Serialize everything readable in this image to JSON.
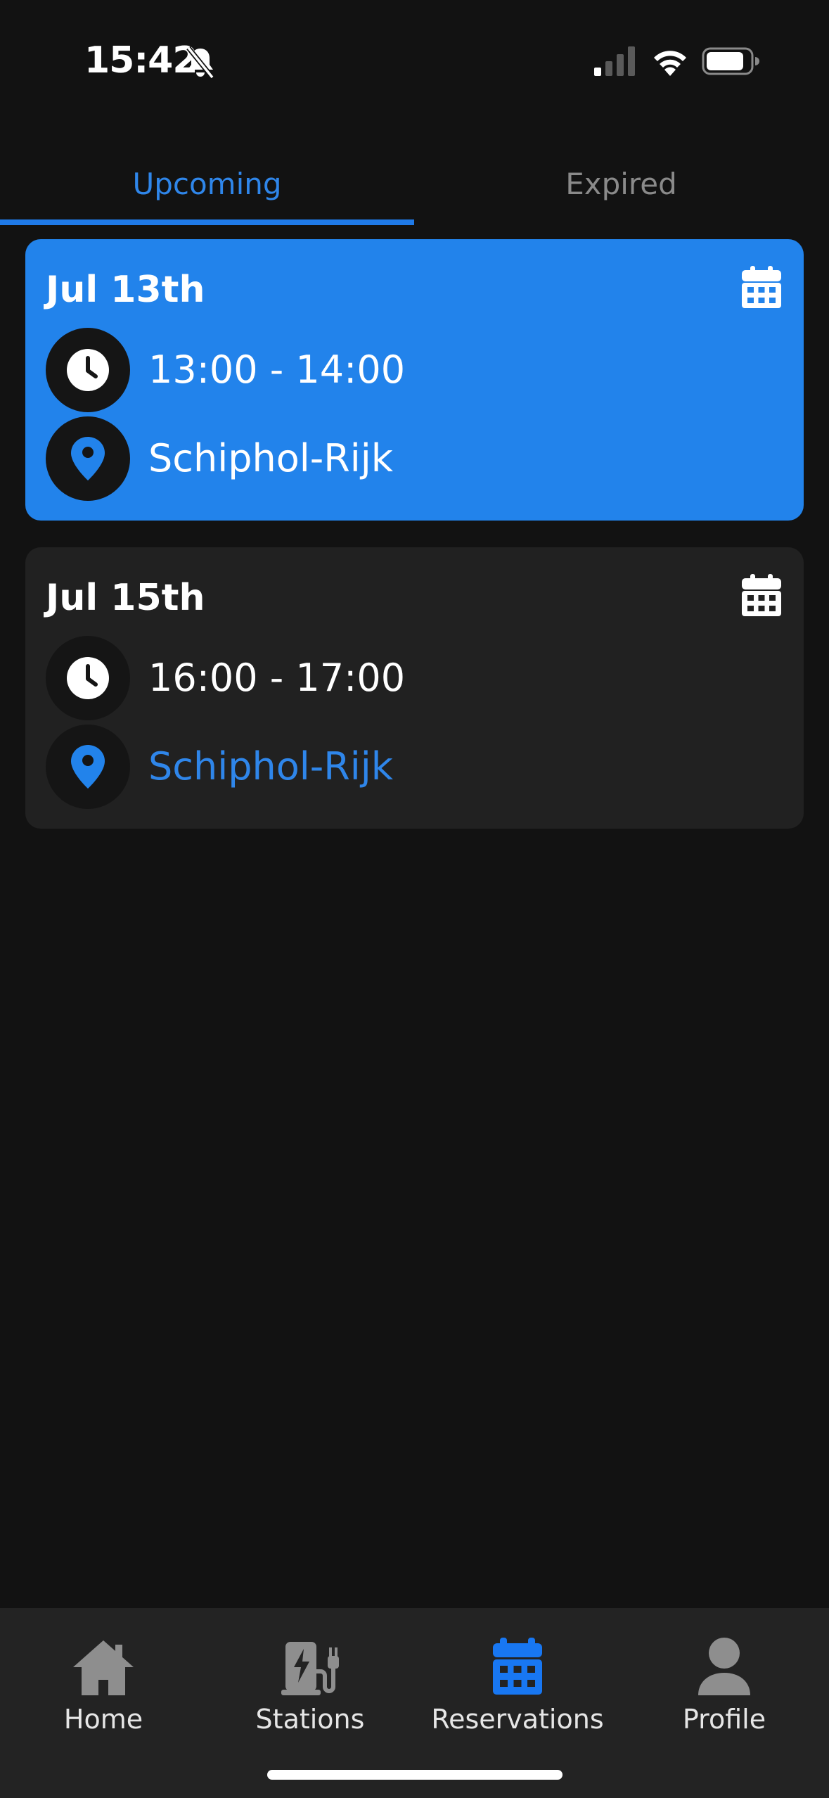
{
  "status_bar": {
    "time": "15:42",
    "icons": [
      "bell-slash-icon",
      "cellular-signal-icon",
      "wifi-icon",
      "battery-icon"
    ]
  },
  "tabs": [
    {
      "label": "Upcoming",
      "active": true
    },
    {
      "label": "Expired",
      "active": false
    }
  ],
  "reservations": [
    {
      "date": "Jul 13th",
      "time": "13:00 - 14:00",
      "location": "Schiphol-Rijk",
      "highlighted": true
    },
    {
      "date": "Jul 15th",
      "time": "16:00 - 17:00",
      "location": "Schiphol-Rijk",
      "highlighted": false
    }
  ],
  "bottom_nav": [
    {
      "label": "Home",
      "icon": "home-icon",
      "active": false
    },
    {
      "label": "Stations",
      "icon": "charging-station-icon",
      "active": false
    },
    {
      "label": "Reservations",
      "icon": "calendar-icon",
      "active": true
    },
    {
      "label": "Profile",
      "icon": "user-icon",
      "active": false
    }
  ],
  "colors": {
    "background": "#121212",
    "accent": "#2283eb",
    "card": "#212121",
    "nav_background": "#232323",
    "inactive_icon": "#8e8e8e"
  }
}
